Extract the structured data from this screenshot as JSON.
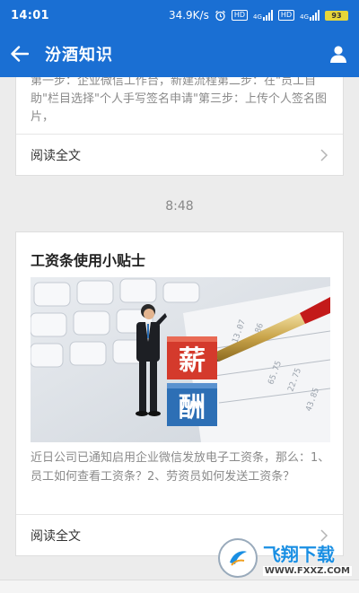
{
  "status": {
    "time": "14:01",
    "net_speed": "34.9K/s",
    "hd": "HD",
    "net_type": "4G",
    "battery": "93"
  },
  "header": {
    "title": "汾酒知识"
  },
  "messages": [
    {
      "excerpt": "第一步：企业微信工作台，新建流程第二步：在\"员工自助\"栏目选择\"个人手写签名申请\"第三步：上传个人签名图片，",
      "read_more": "阅读全文"
    },
    {
      "time": "8:48",
      "title": "工资条使用小贴士",
      "image_chars": [
        "薪",
        "酬"
      ],
      "excerpt": "近日公司已通知启用企业微信发放电子工资条，那么：1、员工如何查看工资条？2、劳资员如何发送工资条？",
      "read_more": "阅读全文"
    }
  ],
  "watermark": {
    "brand": "飞翔下载",
    "url": "WWW.FXXZ.COM"
  },
  "colors": {
    "primary": "#1a6fd3",
    "background": "#ececec"
  }
}
